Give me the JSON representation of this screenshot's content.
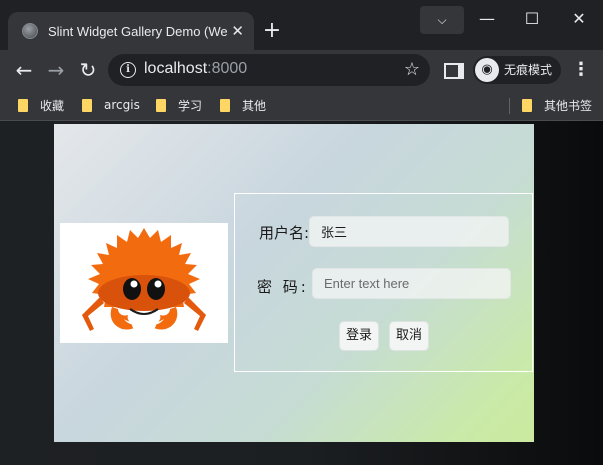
{
  "browser": {
    "tab": {
      "title": "Slint Widget Gallery Demo (We",
      "close_glyph": "✕"
    },
    "new_tab_glyph": "+",
    "tab_search_glyph": "⌵",
    "window_controls": {
      "minimize": "—",
      "maximize": "☐",
      "close": "✕"
    },
    "nav": {
      "back_glyph": "←",
      "forward_glyph": "→",
      "reload_glyph": "↻"
    },
    "address": {
      "host": "localhost",
      "port": ":8000",
      "info_glyph": "i",
      "star_glyph": "☆"
    },
    "incognito": {
      "label": "无痕模式",
      "avatar_glyph": "◉"
    },
    "menu_glyph": "⋮",
    "bookmarks": [
      {
        "label": "收藏"
      },
      {
        "label": "arcgis"
      },
      {
        "label": "学习"
      },
      {
        "label": "其他"
      }
    ],
    "other_bookmarks": "其他书签"
  },
  "app": {
    "username_label": "用户名:",
    "username_value": "张三",
    "password_label": "密 码:",
    "password_placeholder": "Enter text here",
    "login_button": "登录",
    "cancel_button": "取消"
  },
  "colors": {
    "crab_orange": "#f26b0f",
    "crab_shadow": "#c4420b",
    "crab_white": "#ffffff"
  }
}
